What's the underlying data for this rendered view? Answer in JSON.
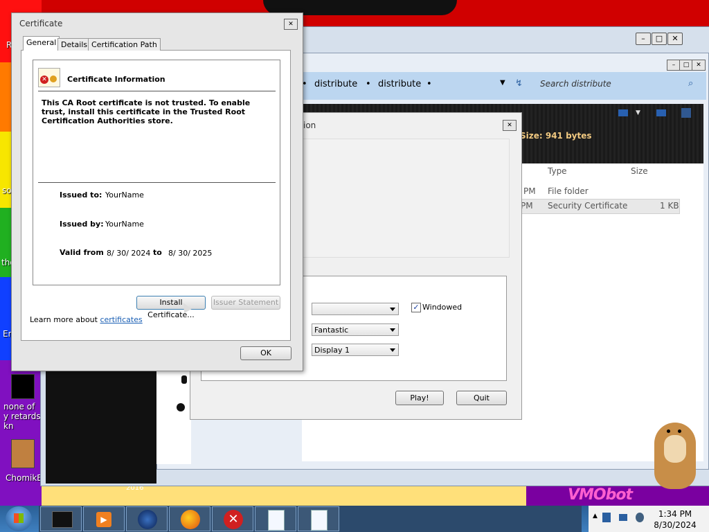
{
  "desktop": {
    "icons": [
      {
        "label": "none of y retards kn"
      },
      {
        "label": "ChomikB"
      }
    ],
    "fragments": [
      "R",
      "so",
      "the",
      "En",
      "2016",
      "VMObot"
    ]
  },
  "explorer": {
    "breadcrumb": [
      "distribute",
      "distribute"
    ],
    "search_placeholder": "Search distribute",
    "size_text": "Size: 941 bytes",
    "columns": [
      "Type",
      "Size"
    ],
    "rows": [
      {
        "time": "PM",
        "type": "File folder",
        "size": ""
      },
      {
        "time": "PM",
        "type": "Security Certificate",
        "size": "1 KB"
      }
    ]
  },
  "launcher": {
    "title_fragment": "ion",
    "combo1": "",
    "combo2": "Fantastic",
    "combo3": "Display 1",
    "windowed_label": "Windowed",
    "windowed_checked": true,
    "play_label": "Play!",
    "quit_label": "Quit"
  },
  "certificate": {
    "title": "Certificate",
    "tabs": [
      "General",
      "Details",
      "Certification Path"
    ],
    "heading": "Certificate Information",
    "warning": "This CA Root certificate is not trusted. To enable trust, install this certificate in the Trusted Root Certification Authorities store.",
    "issued_to_label": "Issued to:",
    "issued_to": "YourName",
    "issued_by_label": "Issued by:",
    "issued_by": "YourName",
    "valid_from_label": "Valid from",
    "valid_from": "8/ 30/ 2024",
    "to_label": "to",
    "valid_to": "8/ 30/ 2025",
    "install_button": "Install Certificate...",
    "issuer_button": "Issuer Statement",
    "learn_more_prefix": "Learn more about",
    "learn_more_link": "certificates",
    "ok_button": "OK"
  },
  "taskbar": {
    "items": [
      "start-orb",
      "terminal",
      "media-player",
      "globe",
      "firefox",
      "error",
      "document",
      "document"
    ],
    "clock_time": "1:34 PM",
    "clock_date": "8/30/2024"
  }
}
